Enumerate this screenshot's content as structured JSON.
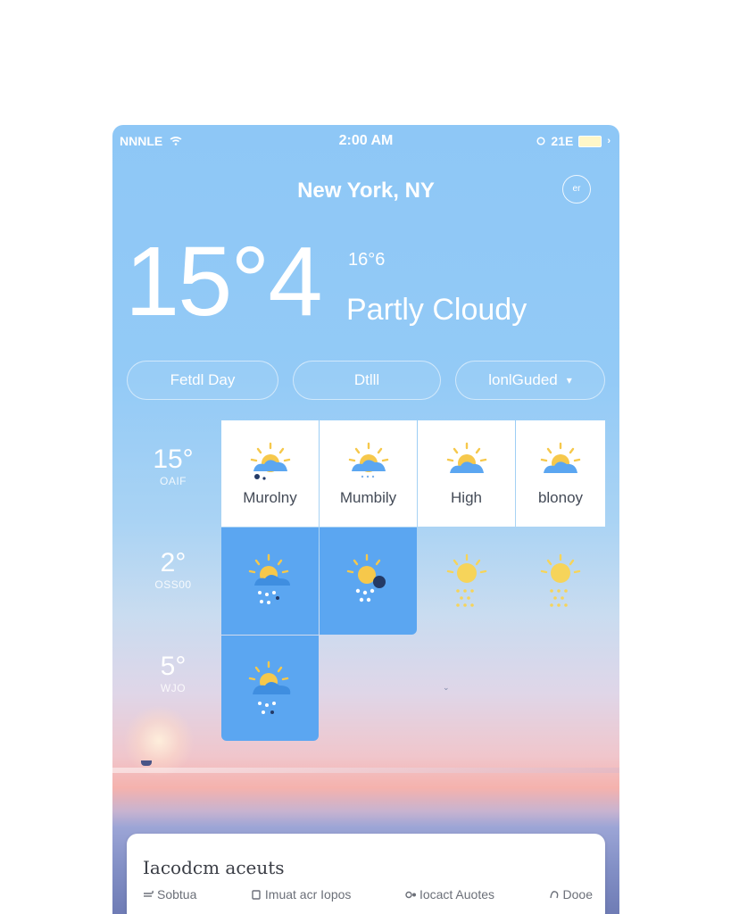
{
  "status_bar": {
    "carrier": "NNNLE",
    "time": "2:00 AM",
    "battery_percent": "21E"
  },
  "header": {
    "city": "New York, NY",
    "settings_icon_label": "er"
  },
  "current": {
    "temp": "15°4",
    "secondary_temp": "16°6",
    "condition": "Partly Cloudy"
  },
  "pills": {
    "first": "Fetdl Day",
    "second": "Dtlll",
    "third": "lonlGuded"
  },
  "rows": [
    {
      "temp": "15°",
      "sub": "OAIF"
    },
    {
      "temp": "2°",
      "sub": "OSS00"
    },
    {
      "temp": "5°",
      "sub": "WJO"
    }
  ],
  "columns": [
    "Murolny",
    "Mumbily",
    "High",
    "blonoy"
  ],
  "icons": {
    "partly_cloudy": "partly-cloudy-icon",
    "rain": "rain-icon",
    "sun_rain": "sun-rain-icon"
  },
  "card": {
    "title": "Iacodcm aceuts",
    "items": [
      "Sobtua",
      "Imuat acr Iopos",
      "Iocact Auotes",
      "Dooe"
    ]
  },
  "colors": {
    "sky_top": "#8ec7f6",
    "cell_blue": "#5ba6f1",
    "cell_white": "#ffffff",
    "sun_yellow": "#f6c84b"
  }
}
